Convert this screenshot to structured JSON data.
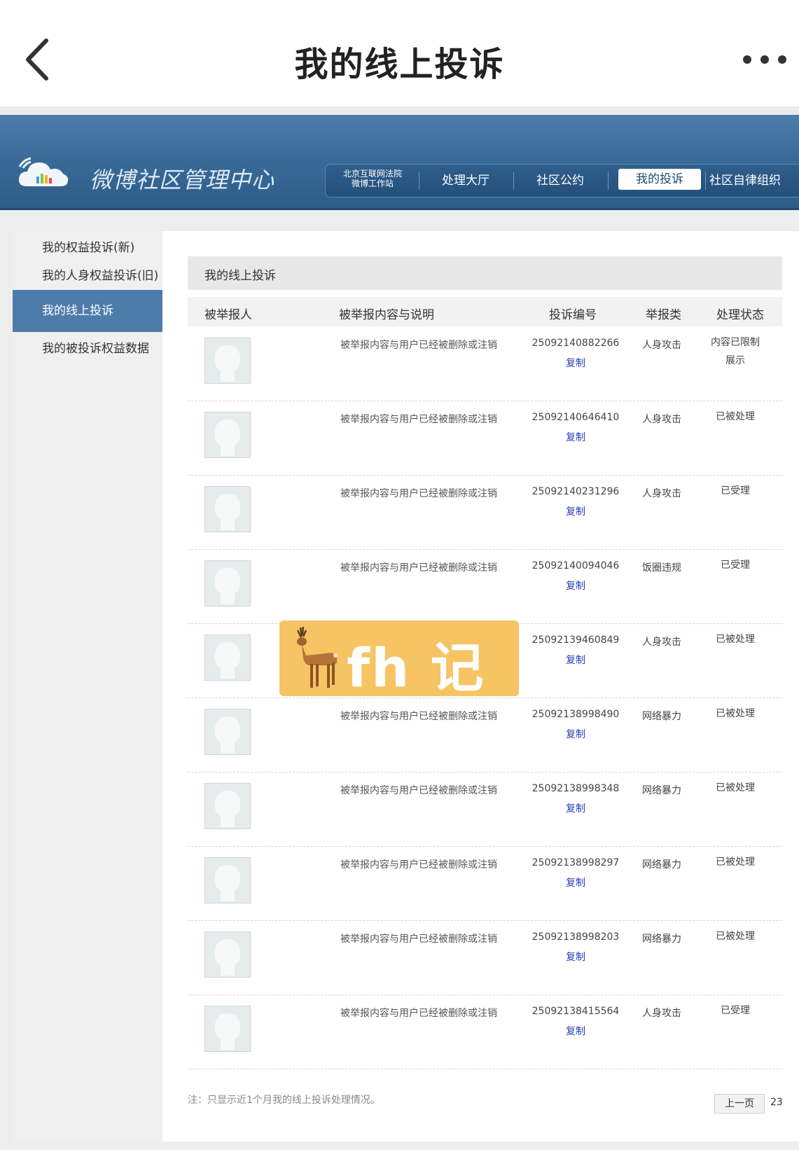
{
  "topbar": {
    "title": "我的线上投诉"
  },
  "header": {
    "logo_text": "微博社区管理中心",
    "court_line1": "北京互联网法院",
    "court_line2": "微博工作站",
    "nav": [
      "处理大厅",
      "社区公约",
      "我的投诉",
      "社区自律组织"
    ],
    "active_nav": "我的投诉"
  },
  "sidebar": {
    "items": [
      "我的权益投诉(新)",
      "我的人身权益投诉(旧)",
      "我的线上投诉",
      "我的被投诉权益数据"
    ],
    "active": "我的线上投诉"
  },
  "panel": {
    "title": "我的线上投诉"
  },
  "table": {
    "headers": [
      "被举报人",
      "被举报内容与说明",
      "投诉编号",
      "举报类",
      "处理状态"
    ],
    "copy_label": "复制",
    "rows": [
      {
        "desc": "被举报内容与用户已经被删除或注销",
        "id": "25092140882266",
        "type": "人身攻击",
        "status": "内容已限制展示"
      },
      {
        "desc": "被举报内容与用户已经被删除或注销",
        "id": "25092140646410",
        "type": "人身攻击",
        "status": "已被处理"
      },
      {
        "desc": "被举报内容与用户已经被删除或注销",
        "id": "25092140231296",
        "type": "人身攻击",
        "status": "已受理"
      },
      {
        "desc": "被举报内容与用户已经被删除或注销",
        "id": "25092140094046",
        "type": "饭圈违规",
        "status": "已受理"
      },
      {
        "desc": "",
        "id": "25092139460849",
        "type": "人身攻击",
        "status": "已被处理"
      },
      {
        "desc": "被举报内容与用户已经被删除或注销",
        "id": "25092138998490",
        "type": "网络暴力",
        "status": "已被处理"
      },
      {
        "desc": "被举报内容与用户已经被删除或注销",
        "id": "25092138998348",
        "type": "网络暴力",
        "status": "已被处理"
      },
      {
        "desc": "被举报内容与用户已经被删除或注销",
        "id": "25092138998297",
        "type": "网络暴力",
        "status": "已被处理"
      },
      {
        "desc": "被举报内容与用户已经被删除或注销",
        "id": "25092138998203",
        "type": "网络暴力",
        "status": "已被处理"
      },
      {
        "desc": "被举报内容与用户已经被删除或注销",
        "id": "25092138415564",
        "type": "人身攻击",
        "status": "已受理"
      }
    ]
  },
  "footer": {
    "note": "注：只显示近1个月我的线上投诉处理情况。",
    "prev_label": "上一页",
    "page_number": "23"
  },
  "watermark": {
    "text": "fh 记录"
  },
  "colors": {
    "banner": "#3a6b98",
    "sidebar_active": "#4d7baa",
    "copy_link": "#2a3fb8",
    "watermark_bg": "#f6c463"
  }
}
